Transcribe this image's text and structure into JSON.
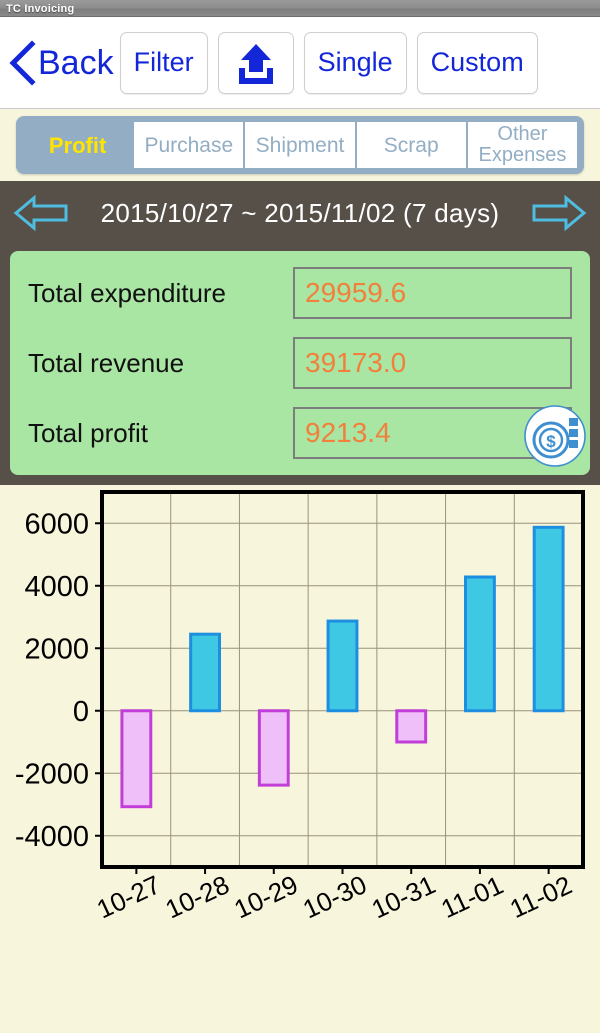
{
  "window": {
    "title": "TC Invoicing"
  },
  "toolbar": {
    "back_label": "Back",
    "filter_label": "Filter",
    "upload_icon": "upload-icon",
    "single_label": "Single",
    "custom_label": "Custom"
  },
  "tabs": {
    "active": "Profit",
    "items": [
      {
        "label": "Profit",
        "active": true
      },
      {
        "label": "Purchase",
        "active": false
      },
      {
        "label": "Shipment",
        "active": false
      },
      {
        "label": "Scrap",
        "active": false
      },
      {
        "label": "Other Expenses",
        "active": false
      }
    ]
  },
  "date_range": {
    "prev_icon": "arrow-left-icon",
    "next_icon": "arrow-right-icon",
    "text": "2015/10/27 ~ 2015/11/02  (7 days)",
    "start": "2015/10/27",
    "end": "2015/11/02",
    "days": "7 days"
  },
  "summary": {
    "rows": [
      {
        "label": "Total expenditure",
        "value": "29959.6"
      },
      {
        "label": "Total revenue",
        "value": "39173.0"
      },
      {
        "label": "Total profit",
        "value": "9213.4"
      }
    ],
    "coin_icon": "coin-dollar-icon",
    "panel_color": "#a9e5a3",
    "value_color": "#f2803c"
  },
  "chart_data": {
    "type": "bar",
    "title": "",
    "xlabel": "",
    "ylabel": "",
    "categories": [
      "10-27",
      "10-28",
      "10-29",
      "10-30",
      "10-31",
      "11-01",
      "11-02"
    ],
    "values": [
      -3070,
      2450,
      -2380,
      2870,
      -1000,
      4280,
      5870
    ],
    "ylim": [
      -5000,
      7000
    ],
    "yticks": [
      6000,
      4000,
      2000,
      0,
      -2000,
      -4000
    ],
    "ytick_labels": [
      "6000",
      "4000",
      "2000",
      "0",
      "-2000",
      "-4000"
    ],
    "grid": true,
    "legend": "none",
    "positive_fill": "#3fc8e4",
    "positive_stroke": "#1e8fe0",
    "negative_fill": "#eebff8",
    "negative_stroke": "#c13fd8",
    "plot_background": "#F7F5DC",
    "axis_color": "#000000",
    "xtick_rotation": -25
  }
}
